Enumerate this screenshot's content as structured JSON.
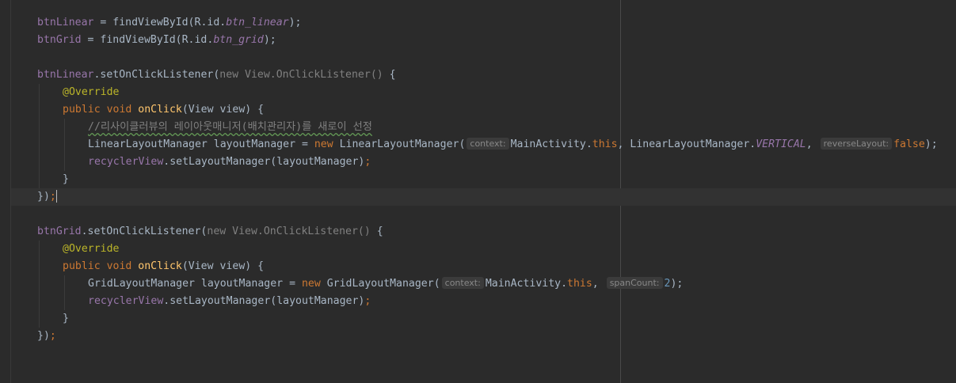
{
  "editor": {
    "lines": {
      "l1": [
        "btnLinear",
        " = findViewById(R.id.",
        "btn_linear",
        ");"
      ],
      "l2": [
        "btnGrid",
        " = findViewById(R.id.",
        "btn_grid",
        ");"
      ],
      "l3": [
        "btnLinear",
        ".setOnClickListener(",
        "new View.OnClickListener()",
        " {"
      ],
      "l4": [
        "@Override"
      ],
      "l5": [
        "public void ",
        "onClick",
        "(View view) {"
      ],
      "l6": [
        "//리사이클러뷰의 레이아웃매니저(배치관리자)를 새로이 선정"
      ],
      "l7": [
        "LinearLayoutManager layoutManager = ",
        "new ",
        "LinearLayoutManager(",
        "context:",
        "MainActivity.",
        "this",
        ", LinearLayoutManager.",
        "VERTICAL",
        ", ",
        "reverseLayout:",
        "false",
        ");"
      ],
      "l8": [
        "recyclerView",
        ".setLayoutManager(layoutManager)",
        ";"
      ],
      "l9": [
        "}"
      ],
      "l10": [
        "})",
        ";"
      ],
      "l11": [
        "btnGrid",
        ".setOnClickListener(",
        "new View.OnClickListener()",
        " {"
      ],
      "l12": [
        "@Override"
      ],
      "l13": [
        "public void ",
        "onClick",
        "(View view) {"
      ],
      "l14": [
        "GridLayoutManager layoutManager = ",
        "new ",
        "GridLayoutManager(",
        "context:",
        "MainActivity.",
        "this",
        ", ",
        "spanCount:",
        "2",
        ");"
      ],
      "l15": [
        "recyclerView",
        ".setLayoutManager(layoutManager)",
        ";"
      ],
      "l16": [
        "}"
      ],
      "l17": [
        "})",
        ";"
      ]
    }
  }
}
